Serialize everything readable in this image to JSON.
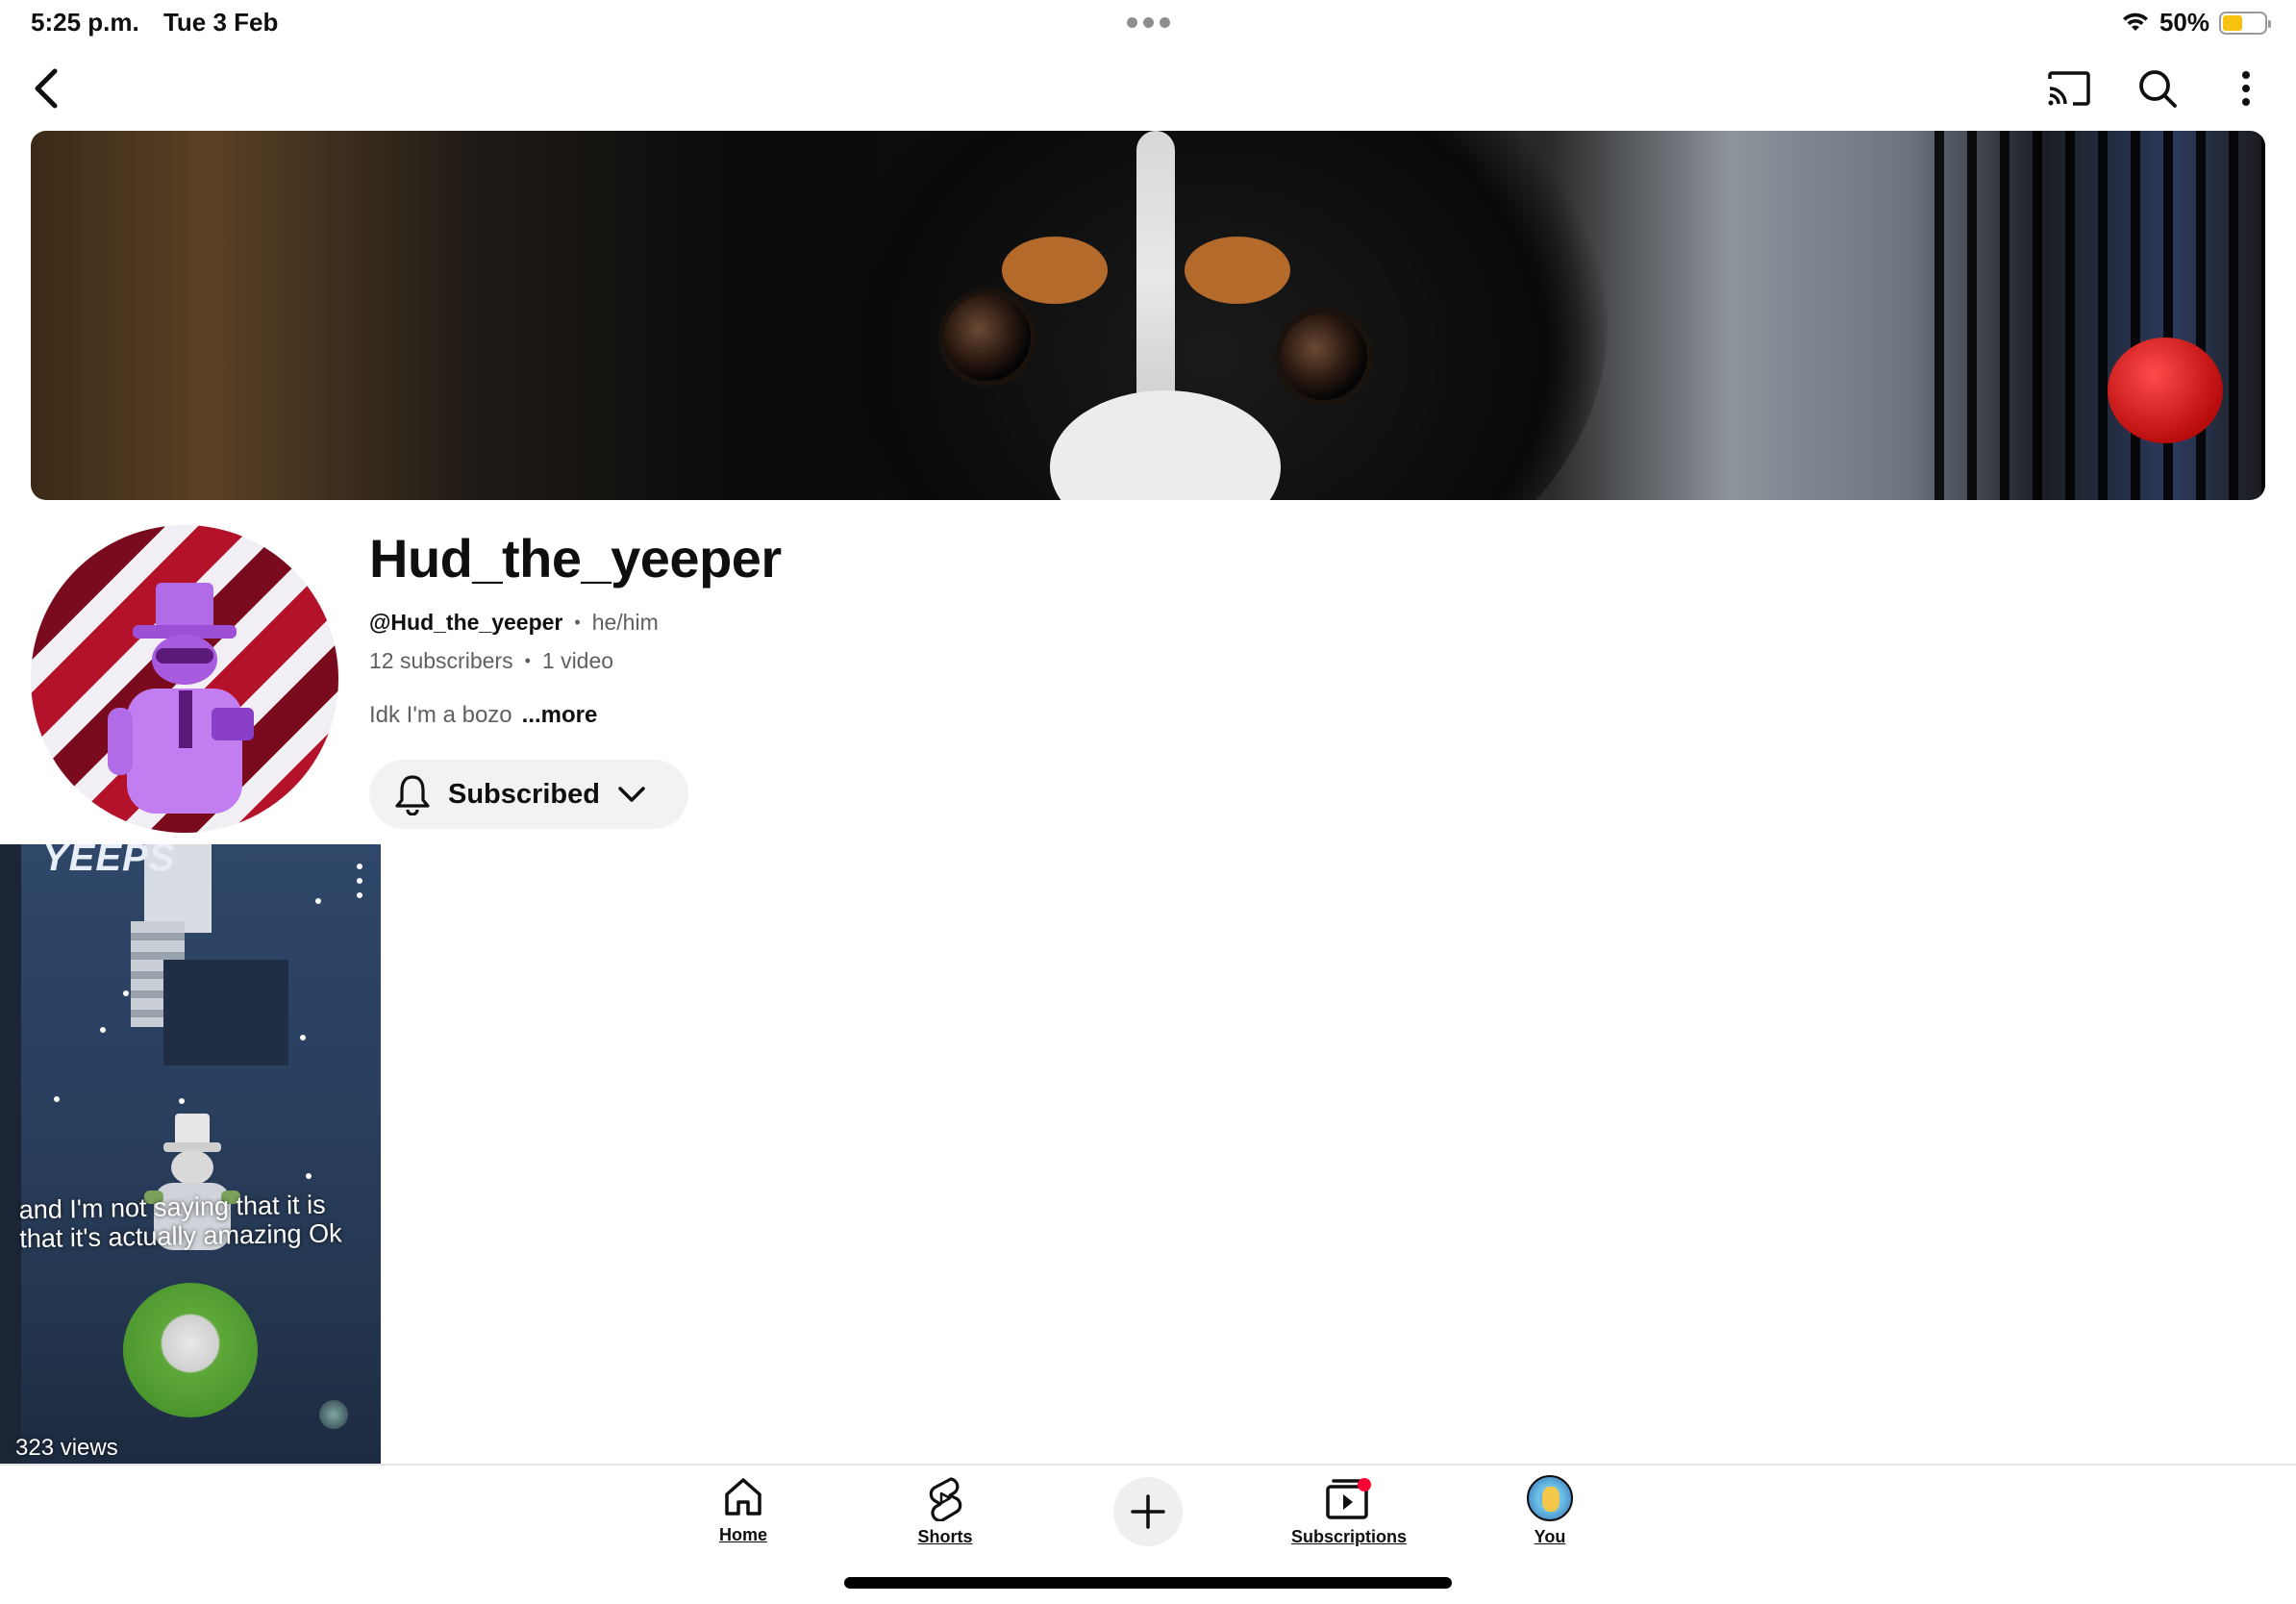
{
  "status_bar": {
    "time": "5:25 p.m.",
    "date": "Tue 3 Feb",
    "battery": "50%",
    "battery_level": 0.5
  },
  "top_bar": {
    "back_icon": "chevron-left-icon",
    "actions": [
      "cast-icon",
      "search-icon",
      "more-vertical-icon"
    ]
  },
  "channel": {
    "name": "Hud_the_yeeper",
    "handle": "@Hud_the_yeeper",
    "pronouns": "he/him",
    "subscribers": "12 subscribers",
    "videos": "1 video",
    "description": "Idk I'm a bozo",
    "more_label": "...more",
    "subscribe_button": "Subscribed",
    "separator": "•"
  },
  "short": {
    "brand_text": "YEEPS",
    "caption_line1": "and I'm not saying that it is",
    "caption_line2": "that it's actually amazing Ok",
    "views": "323 views"
  },
  "bottom_nav": {
    "items": [
      {
        "label": "Home",
        "icon": "home-icon"
      },
      {
        "label": "Shorts",
        "icon": "shorts-icon"
      },
      {
        "label": "",
        "icon": "plus-icon"
      },
      {
        "label": "Subscriptions",
        "icon": "subscriptions-icon"
      },
      {
        "label": "You",
        "icon": "avatar"
      }
    ]
  },
  "colors": {
    "accent_red": "#ff0033",
    "text_primary": "#0f0f0f",
    "text_secondary": "#606060",
    "chip_bg": "#f2f2f2",
    "battery_yellow": "#f6c20d"
  }
}
